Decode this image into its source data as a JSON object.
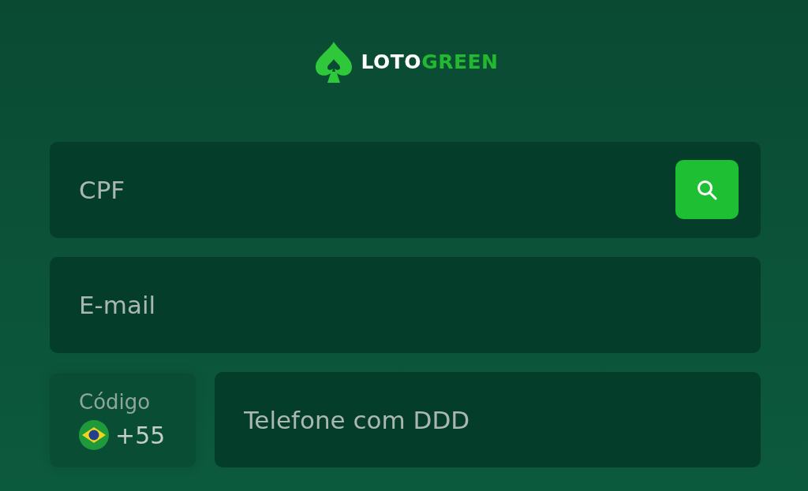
{
  "logo": {
    "part_1": "LOTO",
    "part_2": "GREEN"
  },
  "cpf": {
    "placeholder": "CPF"
  },
  "email": {
    "placeholder": "E-mail"
  },
  "code": {
    "label": "Código",
    "value": "+55"
  },
  "phone": {
    "placeholder": "Telefone com DDD"
  }
}
